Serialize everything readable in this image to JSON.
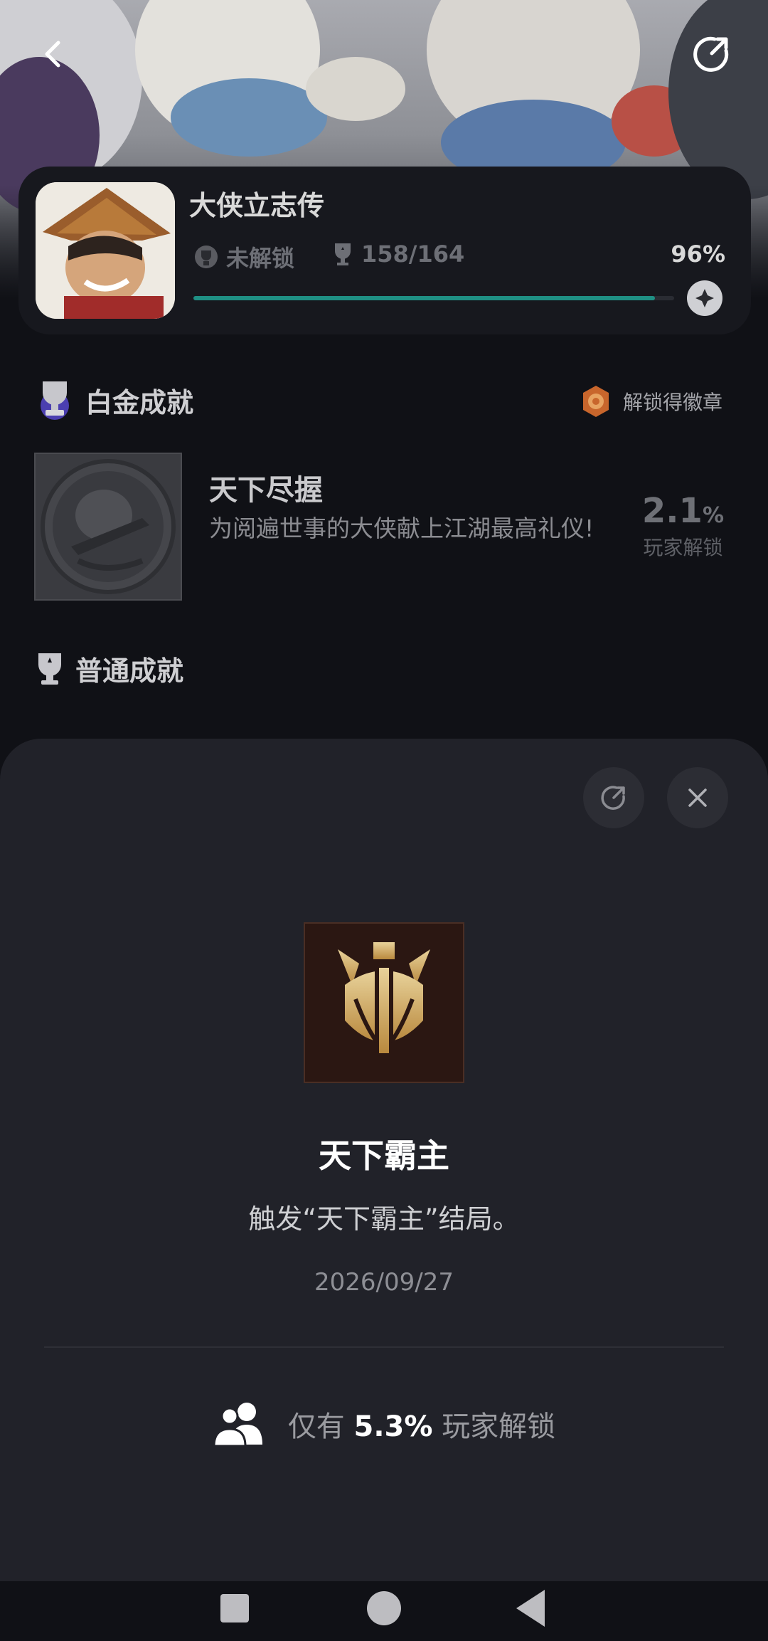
{
  "colors": {
    "accent": "#1f8f84",
    "sheet_bg": "#212229",
    "page_bg": "#101116"
  },
  "game": {
    "title": "大侠立志传",
    "lock_status": "未解锁",
    "trophy_count": "158/164",
    "completion_percent": "96%",
    "completion_fraction": 0.96
  },
  "platinum": {
    "section_title": "白金成就",
    "badge_link": "解锁得徽章",
    "name": "天下尽握",
    "description": "为阅遍世事的大侠献上江湖最高礼仪!",
    "rate_value": "2.1",
    "rate_unit": "%",
    "rate_label": "玩家解锁"
  },
  "normal": {
    "section_title": "普通成就"
  },
  "sheet": {
    "achievement_name": "天下霸主",
    "achievement_desc": "触发“天下霸主”结局。",
    "unlock_date": "2026/09/27",
    "unlock_prefix": "仅有",
    "unlock_percent": "5.3%",
    "unlock_suffix": "玩家解锁"
  },
  "icons": [
    "back-icon",
    "share-icon",
    "lock-trophy-icon",
    "trophy-icon",
    "compass-badge-icon",
    "platinum-trophy-icon",
    "medal-icon",
    "normal-trophy-icon",
    "refresh-share-icon",
    "close-icon",
    "players-icon"
  ]
}
